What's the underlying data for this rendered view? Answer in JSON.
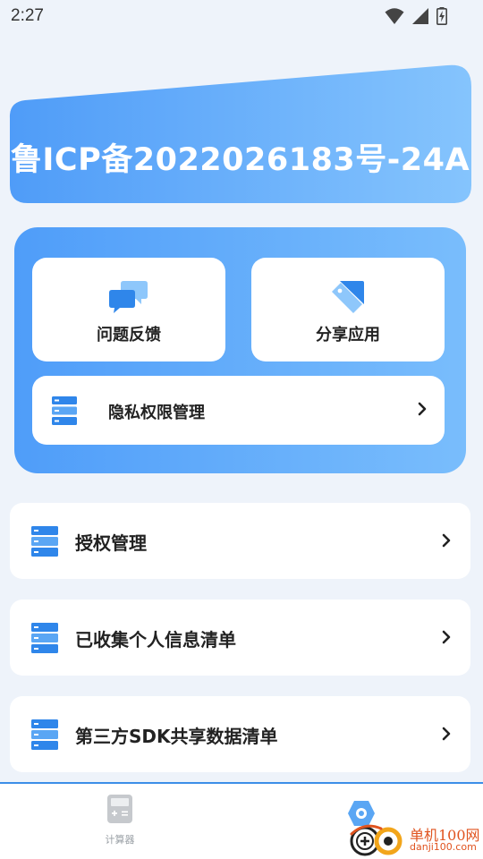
{
  "status_bar": {
    "time": "2:27"
  },
  "banner": {
    "text": "鲁ICP备2022026183号-24A"
  },
  "panel": {
    "feedback_label": "问题反馈",
    "share_label": "分享应用",
    "privacy_label": "隐私权限管理"
  },
  "list": [
    {
      "label": "授权管理"
    },
    {
      "label": "已收集个人信息清单"
    },
    {
      "label": "第三方SDK共享数据清单"
    }
  ],
  "bottom_nav": {
    "calculator_label": "计算器"
  },
  "watermark": {
    "site_name": "单机100网",
    "site_url": "danji100.com"
  },
  "colors": {
    "primary": "#4f9df9",
    "primary_light": "#79bdfc",
    "background": "#eef3fa",
    "watermark": "#e0531f"
  }
}
